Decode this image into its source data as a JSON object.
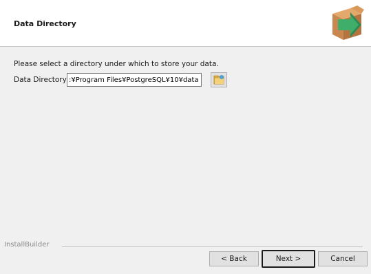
{
  "header": {
    "title": "Data Directory",
    "logo_icon": "installer-box-arrow-icon"
  },
  "main": {
    "instruction": "Please select a directory under which to store your data.",
    "data_directory_label": "Data Directory",
    "data_directory_value": ":¥Program Files¥PostgreSQL¥10¥data",
    "browse_icon": "folder-browse-icon"
  },
  "footer": {
    "brand": "InstallBuilder",
    "back_label": "< Back",
    "next_label": "Next >",
    "cancel_label": "Cancel"
  },
  "colors": {
    "box_brown": "#c8874e",
    "arrow_green": "#3fae6a",
    "window_bg": "#f0f0f0"
  }
}
